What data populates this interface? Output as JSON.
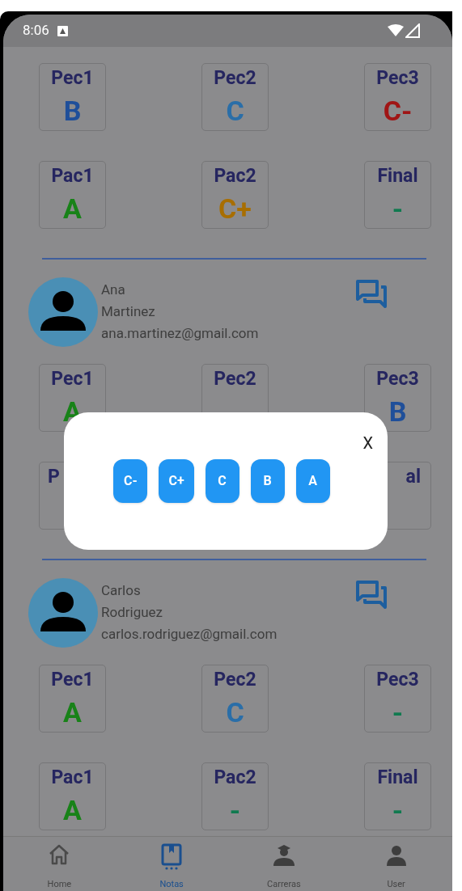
{
  "status_bar": {
    "time": "8:06"
  },
  "students": [
    {
      "grade_rows": [
        [
          {
            "label": "Pec1",
            "grade": "B",
            "color": "#1f4f9a"
          },
          {
            "label": "Pec2",
            "grade": "C",
            "color": "#2a6ea8"
          },
          {
            "label": "Pec3",
            "grade": "C-",
            "color": "#a01515"
          }
        ],
        [
          {
            "label": "Pac1",
            "grade": "A",
            "color": "#188218"
          },
          {
            "label": "Pac2",
            "grade": "C+",
            "color": "#a86e00"
          },
          {
            "label": "Final",
            "grade": "-",
            "color": "#107a50"
          }
        ]
      ]
    },
    {
      "first_name": "Ana",
      "last_name": "Martinez",
      "email": "ana.martinez@gmail.com",
      "grade_rows": [
        [
          {
            "label": "Pec1",
            "grade": "A",
            "color": "#188218"
          },
          {
            "label": "Pec2"
          },
          {
            "label": "Pec3",
            "grade": "B",
            "color": "#1f4f9a"
          }
        ],
        [
          {
            "label": "P"
          },
          {
            "label": "al"
          }
        ]
      ]
    },
    {
      "first_name": "Carlos",
      "last_name": "Rodriguez",
      "email": "carlos.rodriguez@gmail.com",
      "grade_rows": [
        [
          {
            "label": "Pec1",
            "grade": "A",
            "color": "#188218"
          },
          {
            "label": "Pec2",
            "grade": "C",
            "color": "#2a6ea8"
          },
          {
            "label": "Pec3",
            "grade": "-",
            "color": "#107a50"
          }
        ],
        [
          {
            "label": "Pac1",
            "grade": "A",
            "color": "#188218"
          },
          {
            "label": "Pac2",
            "grade": "-",
            "color": "#107a50"
          },
          {
            "label": "Final",
            "grade": "-",
            "color": "#107a50"
          }
        ]
      ]
    }
  ],
  "grade_picker": {
    "close": "X",
    "options": [
      "C-",
      "C+",
      "C",
      "B",
      "A"
    ]
  },
  "bottom_nav": [
    {
      "label": "Home",
      "kind": "home",
      "selected": false
    },
    {
      "label": "Notas",
      "kind": "book",
      "selected": true
    },
    {
      "label": "Carreras",
      "kind": "graduate",
      "selected": false
    },
    {
      "label": "User",
      "kind": "user",
      "selected": false
    }
  ]
}
